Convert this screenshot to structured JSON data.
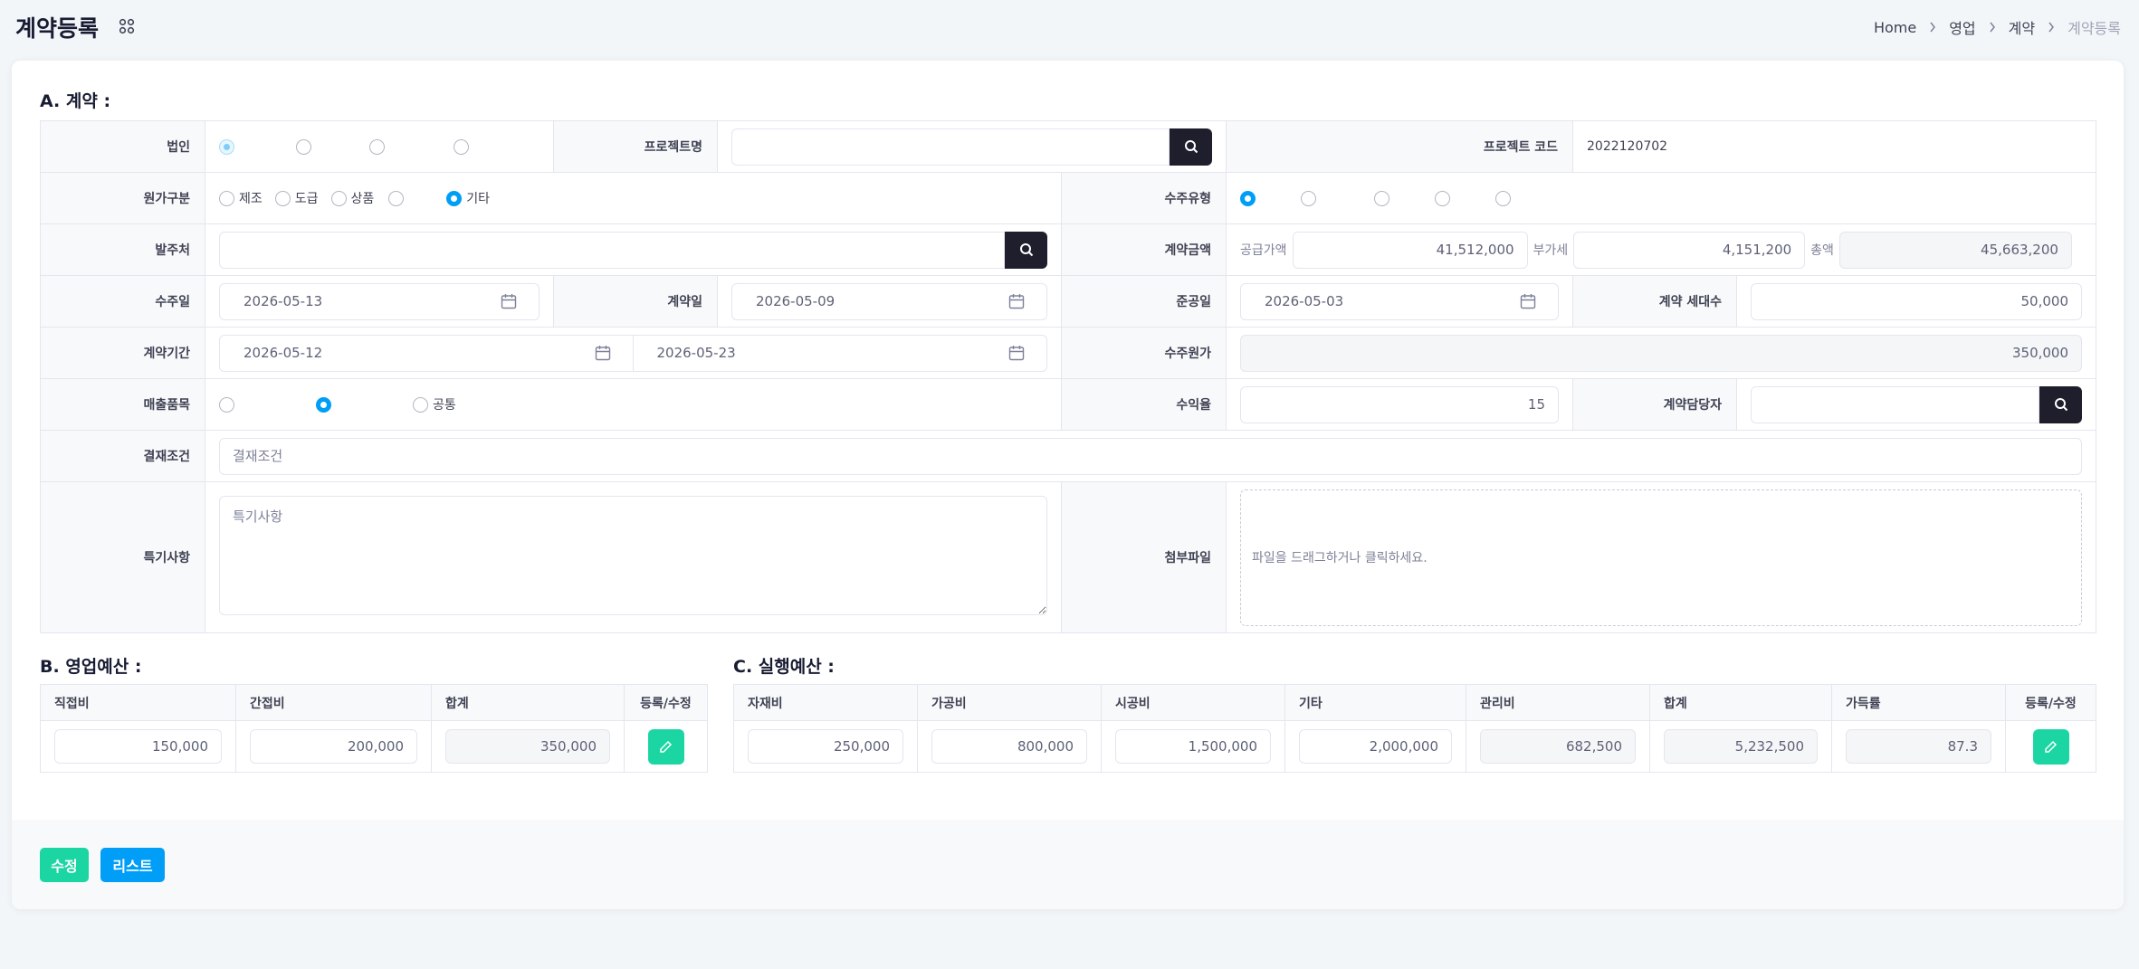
{
  "header": {
    "title": "계약등록",
    "breadcrumb": [
      "Home",
      "영업",
      "계약",
      "계약등록"
    ]
  },
  "colors": {
    "primary": "#009ef7",
    "success": "#1bd6a3",
    "dark": "#1e1e2d"
  },
  "sectionA": {
    "title": "A. 계약 :",
    "labels": {
      "corp": "법인",
      "project_name": "프로젝트명",
      "project_code": "프로젝트 코드",
      "cost_type": "원가구분",
      "order_type": "수주유형",
      "client": "발주처",
      "contract_amount": "계약금액",
      "order_date": "수주일",
      "contract_date": "계약일",
      "completion_date": "준공일",
      "households": "계약 세대수",
      "period": "계약기간",
      "order_cost": "수주원가",
      "sales_item": "매출품목",
      "profit_rate": "수익율",
      "manager": "계약담당자",
      "payment": "결재조건",
      "notes": "특기사항",
      "attachment": "첨부파일"
    },
    "values": {
      "project_code": "2022120702",
      "cost_options": [
        "제조",
        "도급",
        "상품",
        "",
        "기타"
      ],
      "supply_label": "공급가액",
      "supply_value": "41,512,000",
      "vat_label": "부가세",
      "vat_value": "4,151,200",
      "total_label": "총액",
      "total_value": "45,663,200",
      "order_date": "2026-05-13",
      "contract_date": "2026-05-09",
      "completion_date": "2026-05-03",
      "households": "50,000",
      "period_start": "2026-05-12",
      "period_end": "2026-05-23",
      "order_cost": "350,000",
      "sales_common": "공통",
      "profit_rate": "15",
      "payment_placeholder": "결재조건",
      "notes_placeholder": "특기사항",
      "dropzone_text": "파일을 드래그하거나 클릭하세요."
    }
  },
  "sectionB": {
    "title": "B. 영업예산 :",
    "headers": [
      "직접비",
      "간접비",
      "합계",
      "등록/수정"
    ],
    "values": [
      "150,000",
      "200,000",
      "350,000"
    ]
  },
  "sectionC": {
    "title": "C. 실행예산 :",
    "headers": [
      "자재비",
      "가공비",
      "시공비",
      "기타",
      "관리비",
      "합계",
      "가득률",
      "등록/수정"
    ],
    "values": [
      "250,000",
      "800,000",
      "1,500,000",
      "2,000,000",
      "682,500",
      "5,232,500",
      "87.3"
    ]
  },
  "footer": {
    "edit_label": "수정",
    "list_label": "리스트"
  }
}
